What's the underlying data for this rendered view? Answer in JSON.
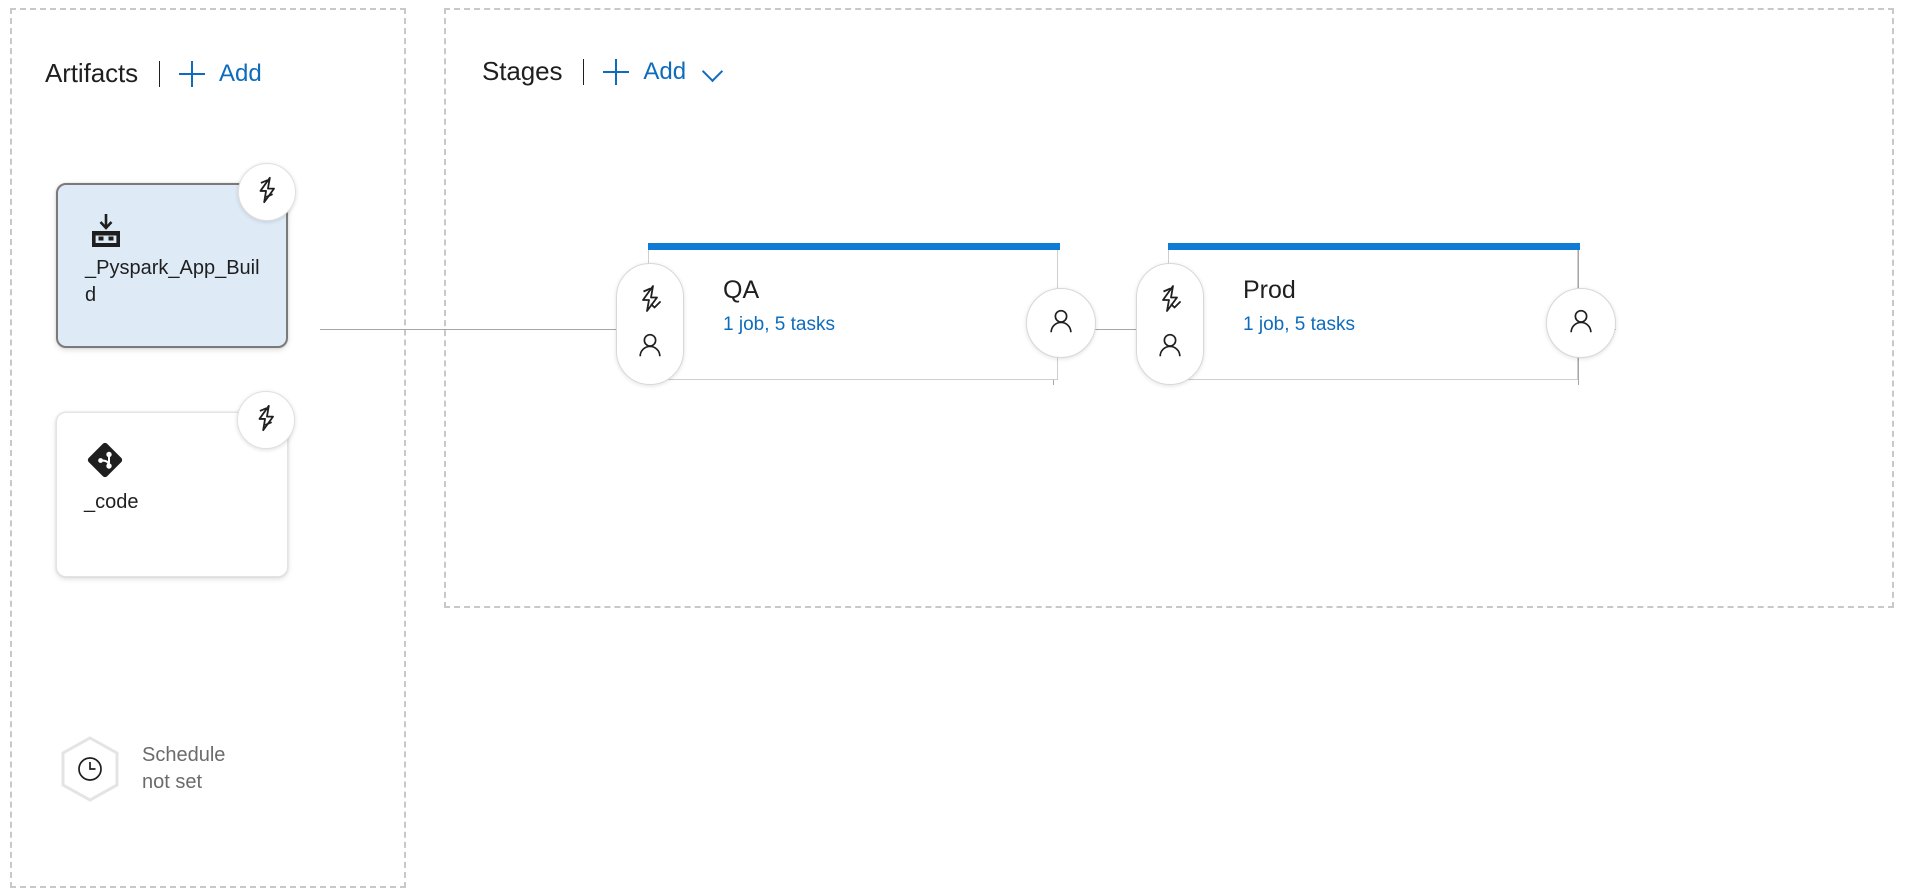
{
  "artifacts_panel": {
    "title": "Artifacts",
    "add_label": "Add",
    "add_icon": "plus-icon",
    "items": [
      {
        "name": "_Pyspark_App_Build",
        "icon": "build-artifact-icon",
        "selected": true,
        "trigger_icon": "lightning-bolt-icon",
        "trigger_enabled": true
      },
      {
        "name": "_code",
        "icon": "git-repository-icon",
        "selected": false,
        "trigger_icon": "lightning-bolt-icon",
        "trigger_enabled": true
      }
    ],
    "schedule": {
      "icon": "clock-hexagon-icon",
      "line1": "Schedule",
      "line2": "not set"
    }
  },
  "stages_panel": {
    "title": "Stages",
    "add_label": "Add",
    "add_icon": "plus-icon",
    "dropdown_icon": "chevron-down-icon",
    "stages": [
      {
        "name": "QA",
        "summary": "1 job, 5 tasks",
        "accent_color": "#0f7bd4",
        "pre_deploy_icons": [
          "lightning-bolt-check-icon",
          "person-icon"
        ],
        "post_deploy_icons": [
          "person-icon"
        ]
      },
      {
        "name": "Prod",
        "summary": "1 job, 5 tasks",
        "accent_color": "#0f7bd4",
        "pre_deploy_icons": [
          "lightning-bolt-check-icon",
          "person-icon"
        ],
        "post_deploy_icons": [
          "person-icon"
        ]
      }
    ]
  },
  "colors": {
    "accent_blue": "#0f7bd4",
    "link_blue": "#0f6cbd",
    "selected_card_fill": "#deebf7",
    "panel_dash": "#c8c8c8",
    "connector": "#a6a6a6",
    "muted_text": "#6b6b6b"
  }
}
